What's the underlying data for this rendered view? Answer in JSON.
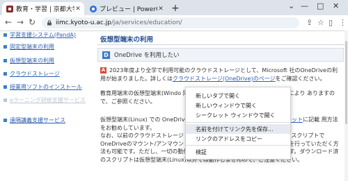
{
  "browser": {
    "tabs": [
      {
        "title": "教育・学習 | 京都大学情報",
        "favicon": "kyoto-favicon"
      },
      {
        "title": "プレビュー | PowerCMS P",
        "favicon": "powercms-favicon"
      }
    ],
    "new_tab": "+",
    "controls": {
      "chevron": "⌄",
      "minimize": "—",
      "maximize": "□",
      "close": "✕"
    },
    "address": {
      "host": "iimc.kyoto-u.ac.jp",
      "path": "/ja/services/education/"
    }
  },
  "sidebar": {
    "items": [
      {
        "label": "学習支援システム(PandA)",
        "dim": false
      },
      {
        "label": "固定型端末の利用",
        "dim": false
      },
      {
        "label": "仮想型端末の利用",
        "dim": false
      },
      {
        "label": "クラウドストレージ",
        "dim": false
      },
      {
        "label": "授業用ソフトのインストール",
        "dim": false
      },
      {
        "label": "eラーニング研修支援サービス",
        "dim": true
      },
      {
        "label": "遠隔講義支援サービス",
        "dim": false
      }
    ]
  },
  "main": {
    "title": "仮想型端末の利用",
    "section_icon": "D",
    "section_label": "OneDrive を利用したい",
    "badge": "A",
    "para1_a": "2023年度より全学で利用可能のクラウドストレージとして、Microsoft 社のOneDriveの利用が始まりました。詳しくは",
    "para1_link": "クラウドストレージ(OneDrive)のページ",
    "para1_b": "をご確認ください。",
    "para2": "教育用端末の仮想型端末(Windo                                                      同社製の同期ソフトウェアを導入することにより                                                   ありますので、ご参照ください。",
    "para3_a": "仮想型端末(Linux) での OneDriv                                          ウェアの用意がありませんので、",
    "para3_link": "リーフレット",
    "para3_b": "に記載                                                      用方法をお勧めしています。",
    "para4": "なお、以前のクラウドストレージ                                                     ントさせての利用を希望されます場合は、スクリプトでOneDriveのマウント/アンマウントを行っていただき、次の画面通りの操作を行っていただく方法も可能です。ただし、一切の動作保証はなくフリーソフトウェアの利用です。ダウンロード済のスクリプトは仮想型端末(Linux)以外では動作しませんので、ご注意ください。"
  },
  "context_menu": {
    "items": [
      "新しいタブで開く",
      "新しいウィンドウで開く",
      "シークレット ウィンドウで開く",
      "名前を付けてリンク先を保存...",
      "リンクのアドレスをコピー",
      "検証"
    ],
    "highlighted_index": 3
  },
  "colors": {
    "accent": "#3a78c9",
    "link": "#2a5db0",
    "badge": "#e0443a"
  }
}
